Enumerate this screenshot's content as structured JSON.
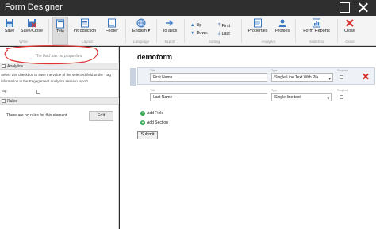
{
  "window": {
    "title": "Form Designer"
  },
  "ribbon": {
    "buttons": {
      "save": "Save",
      "save_close": "Save/Close",
      "title": "Title",
      "introduction": "Introduction",
      "footer": "Footer",
      "language": "English",
      "to_ascx": "To ascx",
      "up": "Up",
      "down": "Down",
      "first": "First",
      "last": "Last",
      "properties": "Properties",
      "profiles": "Profiles",
      "form_reports": "Form Reports",
      "close": "Close"
    },
    "groups": {
      "write": "Write",
      "layout": "Layout",
      "language": "Language",
      "export": "Export",
      "sorting": "Sorting",
      "analytics": "Analytics",
      "switch_to": "Switch to",
      "close": "Close"
    }
  },
  "left_panel": {
    "no_properties": "The field has no properties.",
    "analytics_header": "Analytics",
    "analytics_description": "Select this checkbox to save the value of the selected field to the \"Tag\" information in the Engagement Analytics session report.",
    "tag_label": "Tag:",
    "rules_header": "Rules",
    "rules_text": "There are no rules for this element.",
    "edit_button": "Edit"
  },
  "form": {
    "name": "demoform",
    "labels": {
      "title": "Title",
      "type": "Type",
      "required": "Required"
    },
    "fields": [
      {
        "title": "First Name",
        "type": "Single Line Text With Pla"
      },
      {
        "title": "Last Name",
        "type": "Single-line text"
      }
    ],
    "add_field": "Add Field",
    "add_section": "Add Section",
    "submit": "Submit"
  },
  "colors": {
    "titlebar": "#2f2f2f",
    "ribbon_icon_blue": "#3b78c4",
    "delete_red": "#d9312b",
    "add_green": "#2fa84f",
    "annotation_red": "#e03232"
  }
}
